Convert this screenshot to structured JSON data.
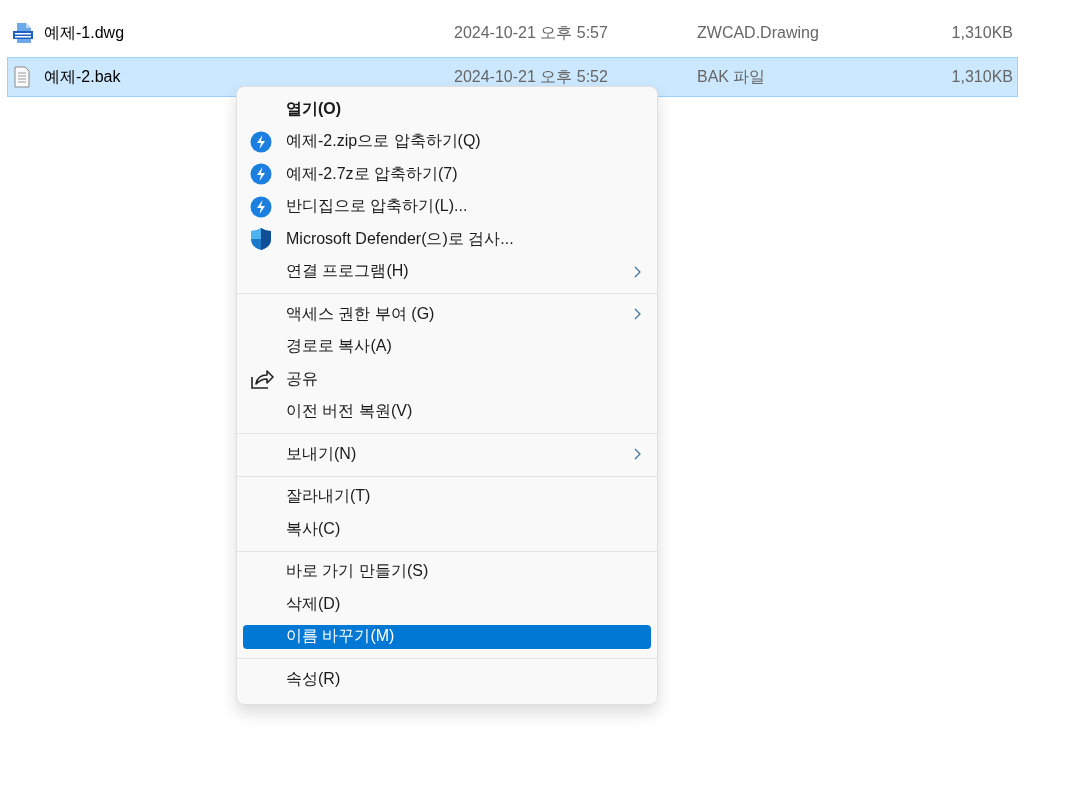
{
  "files": [
    {
      "name": "예제-1.dwg",
      "kind": "drawing",
      "date": "2024-10-21 오후 5:57",
      "type": "ZWCAD.Drawing",
      "size": "1,310KB",
      "selected": false
    },
    {
      "name": "예제-2.bak",
      "kind": "document",
      "date": "2024-10-21 오후 5:52",
      "type": "BAK 파일",
      "size": "1,310KB",
      "selected": true
    }
  ],
  "context_menu": {
    "groups": [
      [
        {
          "label": "열기(O)",
          "bold": true,
          "kind": "plain",
          "submenu": false,
          "selected": false
        },
        {
          "label": "예제-2.zip으로 압축하기(Q)",
          "bold": false,
          "kind": "compress",
          "submenu": false,
          "selected": false
        },
        {
          "label": "예제-2.7z로 압축하기(7)",
          "bold": false,
          "kind": "compress",
          "submenu": false,
          "selected": false
        },
        {
          "label": "반디집으로 압축하기(L)...",
          "bold": false,
          "kind": "compress",
          "submenu": false,
          "selected": false
        },
        {
          "label": "Microsoft Defender(으)로 검사...",
          "bold": false,
          "kind": "scan",
          "submenu": false,
          "selected": false
        },
        {
          "label": "연결 프로그램(H)",
          "bold": false,
          "kind": "plain",
          "submenu": true,
          "selected": false
        }
      ],
      [
        {
          "label": "액세스 권한 부여 (G)",
          "bold": false,
          "kind": "plain",
          "submenu": true,
          "selected": false
        },
        {
          "label": "경로로 복사(A)",
          "bold": false,
          "kind": "plain",
          "submenu": false,
          "selected": false
        },
        {
          "label": "공유",
          "bold": false,
          "kind": "share",
          "submenu": false,
          "selected": false
        },
        {
          "label": "이전 버전 복원(V)",
          "bold": false,
          "kind": "plain",
          "submenu": false,
          "selected": false
        }
      ],
      [
        {
          "label": "보내기(N)",
          "bold": false,
          "kind": "plain",
          "submenu": true,
          "selected": false
        }
      ],
      [
        {
          "label": "잘라내기(T)",
          "bold": false,
          "kind": "plain",
          "submenu": false,
          "selected": false
        },
        {
          "label": "복사(C)",
          "bold": false,
          "kind": "plain",
          "submenu": false,
          "selected": false
        }
      ],
      [
        {
          "label": "바로 가기 만들기(S)",
          "bold": false,
          "kind": "plain",
          "submenu": false,
          "selected": false
        },
        {
          "label": "삭제(D)",
          "bold": false,
          "kind": "plain",
          "submenu": false,
          "selected": false
        },
        {
          "label": "이름 바꾸기(M)",
          "bold": false,
          "kind": "plain",
          "submenu": false,
          "selected": true
        }
      ],
      [
        {
          "label": "속성(R)",
          "bold": false,
          "kind": "plain",
          "submenu": false,
          "selected": false
        }
      ]
    ]
  }
}
